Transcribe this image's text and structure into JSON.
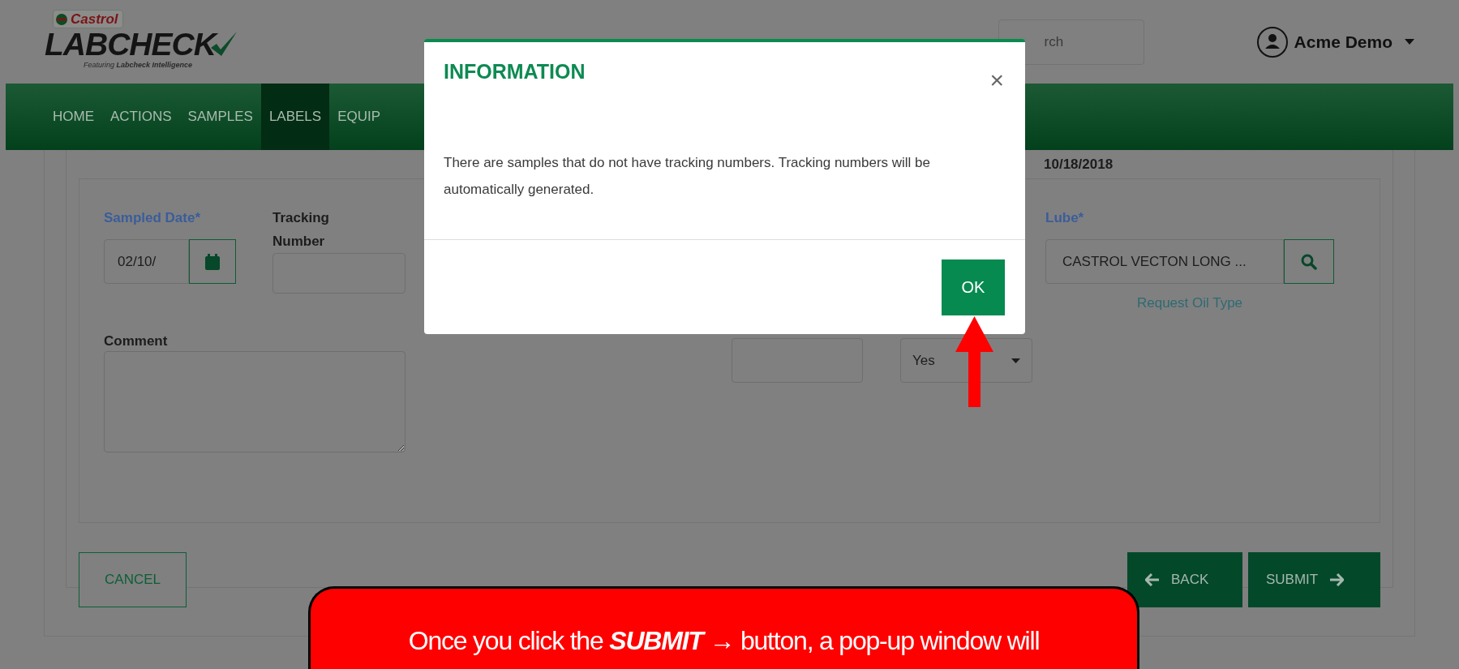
{
  "header": {
    "logo": {
      "brand": "Castrol",
      "product": "LABCHECK",
      "tagline": "Featuring **Labcheck Intelligence**"
    },
    "search": {
      "placeholder": "rch"
    },
    "user": {
      "name": "Acme Demo"
    }
  },
  "nav": [
    {
      "label": "HOME",
      "selected": false
    },
    {
      "label": "ACTIONS",
      "selected": false
    },
    {
      "label": "SAMPLES",
      "selected": false
    },
    {
      "label": "LABELS",
      "selected": true
    },
    {
      "label": "EQUIP",
      "selected": false
    }
  ],
  "form": {
    "date_header": "10/18/2018",
    "sampled_date": {
      "label": "Sampled Date*",
      "value": "02/10/"
    },
    "tracking_number": {
      "label": "Tracking Number"
    },
    "lube": {
      "label": "Lube*",
      "value": "CASTROL VECTON LONG ...",
      "link": "Request Oil Type"
    },
    "comment": {
      "label": "Comment"
    },
    "select": {
      "value": "Yes"
    }
  },
  "actions": [
    {
      "label": "CANCEL",
      "kind": "cancel"
    },
    {
      "label": "BACK",
      "kind": "back"
    },
    {
      "label": "SUBMIT",
      "kind": "submit"
    }
  ],
  "dialog": {
    "title": "INFORMATION",
    "close": "×",
    "message": "There are samples that do not have tracking numbers. Tracking numbers will be automatically generated.",
    "button": "OK"
  },
  "callout": {
    "text": "Once you click the **SUBMIT** → button, a pop-up window will"
  }
}
